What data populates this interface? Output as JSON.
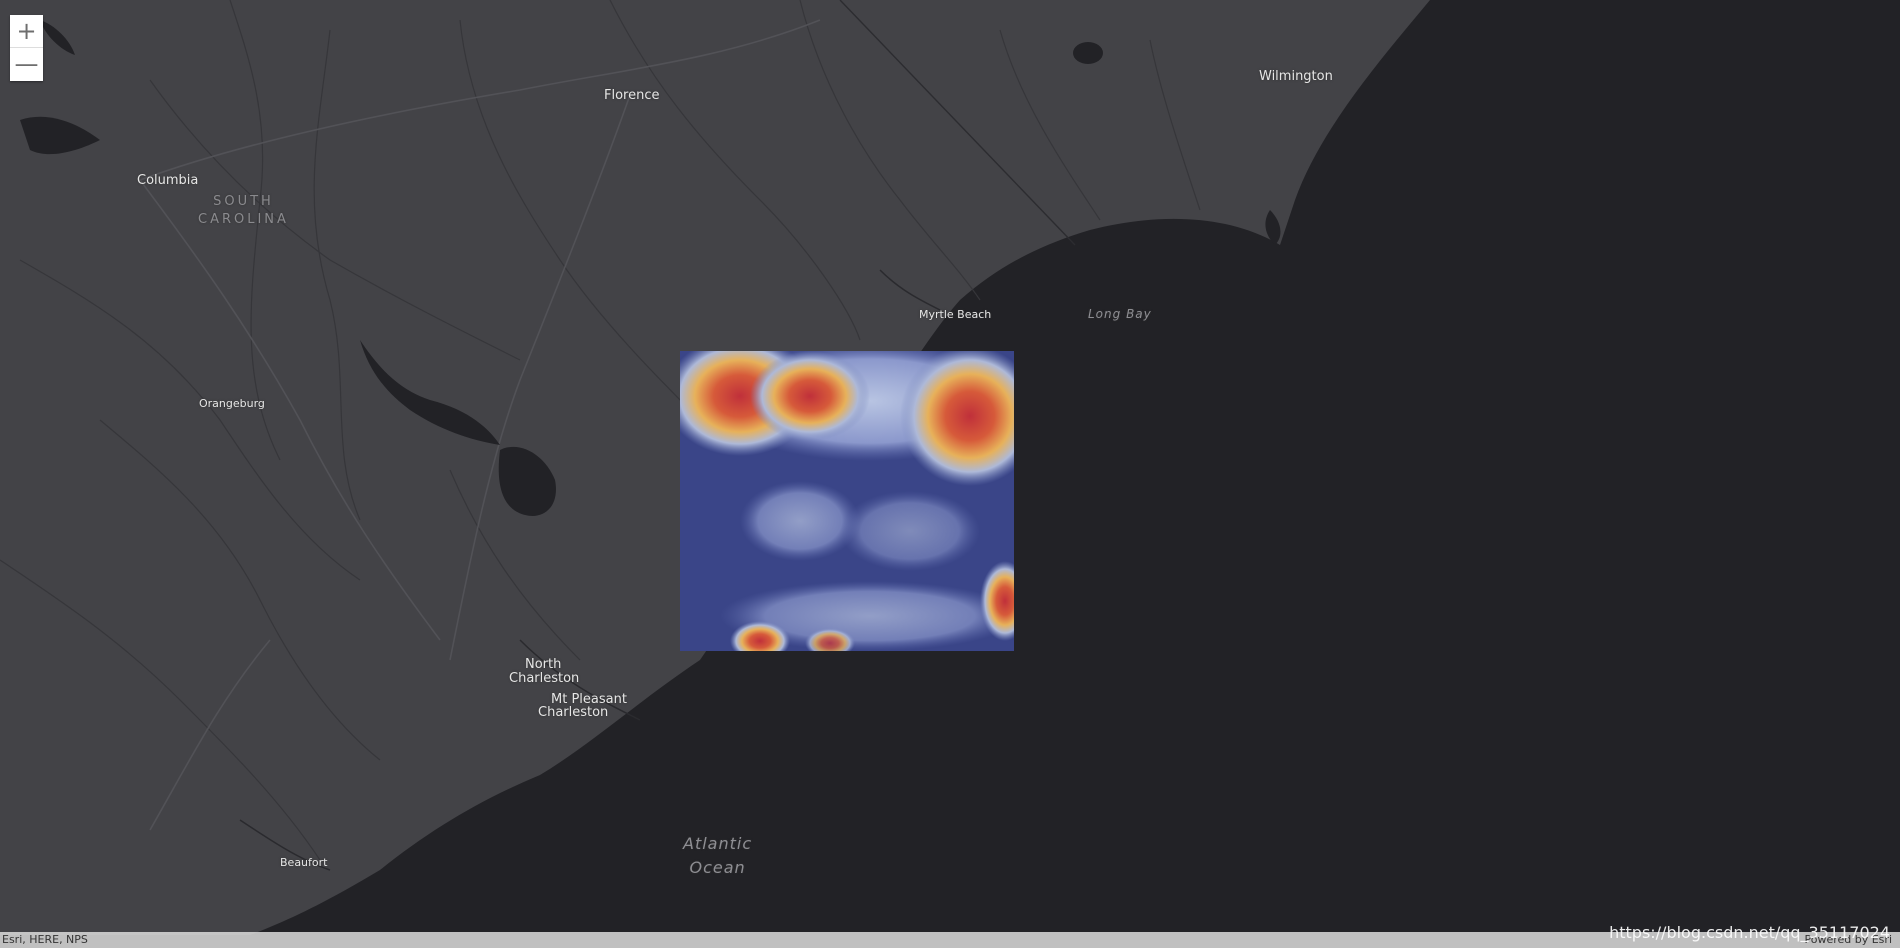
{
  "zoom": {
    "in_label": "+",
    "out_label": "—"
  },
  "cities": {
    "florence": "Florence",
    "wilmington": "Wilmington",
    "columbia": "Columbia",
    "orangeburg": "Orangeburg",
    "myrtle_beach": "Myrtle Beach",
    "north_charleston_1": "North",
    "north_charleston_2": "Charleston",
    "mt_pleasant": "Mt Pleasant",
    "charleston": "Charleston",
    "beaufort": "Beaufort"
  },
  "regions": {
    "state_line1": "SOUTH",
    "state_line2": "CAROLINA"
  },
  "water": {
    "long_bay": "Long Bay",
    "ocean_line1": "Atlantic",
    "ocean_line2": "Ocean"
  },
  "attribution": {
    "sources": "Esri, HERE, NPS",
    "powered_by": "Powered by Esri"
  },
  "watermark": "https://blog.csdn.net/qq_35117024",
  "colors": {
    "land": "#434347",
    "water": "#222226",
    "overlay_base": "#3a4588"
  }
}
